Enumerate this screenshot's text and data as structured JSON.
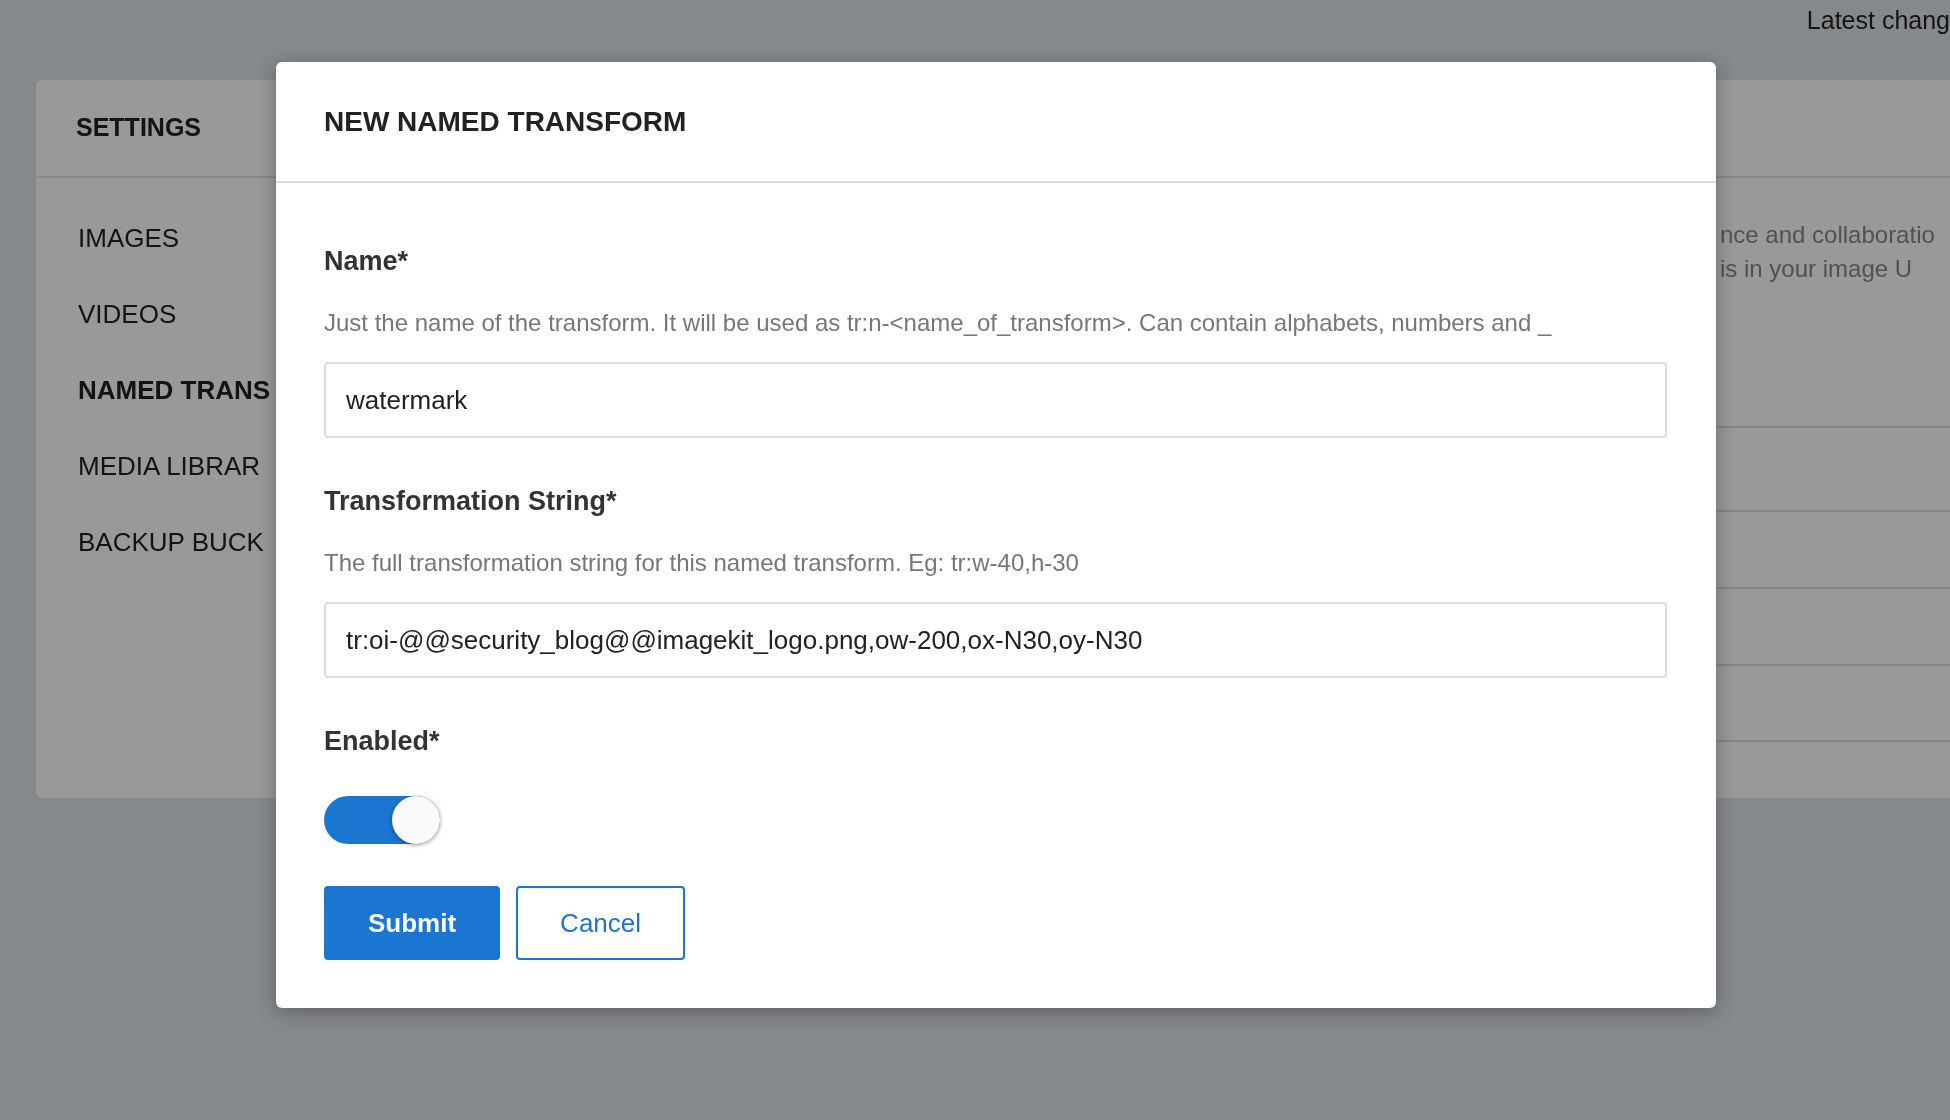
{
  "page": {
    "top_text": "Latest chang"
  },
  "settings": {
    "title": "SETTINGS",
    "items": [
      {
        "label": "IMAGES",
        "selected": false
      },
      {
        "label": "VIDEOS",
        "selected": false
      },
      {
        "label": "NAMED TRANS",
        "selected": true
      },
      {
        "label": "MEDIA LIBRAR",
        "selected": false
      },
      {
        "label": "BACKUP BUCK",
        "selected": false
      }
    ],
    "panel_lines": [
      "nce and collaboratio",
      "is in your image U"
    ]
  },
  "modal": {
    "title": "NEW NAMED TRANSFORM",
    "fields": [
      {
        "kind": "text",
        "label": "Name*",
        "help": "Just the name of the transform. It will be used as tr:n-<name_of_transform>. Can contain alphabets, numbers and _",
        "value": "watermark"
      },
      {
        "kind": "text",
        "label": "Transformation String*",
        "help": "The full transformation string for this named transform. Eg: tr:w-40,h-30",
        "value": "tr:oi-@@security_blog@@imagekit_logo.png,ow-200,ox-N30,oy-N30"
      },
      {
        "kind": "switch",
        "label": "Enabled*",
        "on": true
      }
    ],
    "buttons": [
      {
        "label": "Submit",
        "kind": "primary"
      },
      {
        "label": "Cancel",
        "kind": "outline"
      }
    ]
  }
}
